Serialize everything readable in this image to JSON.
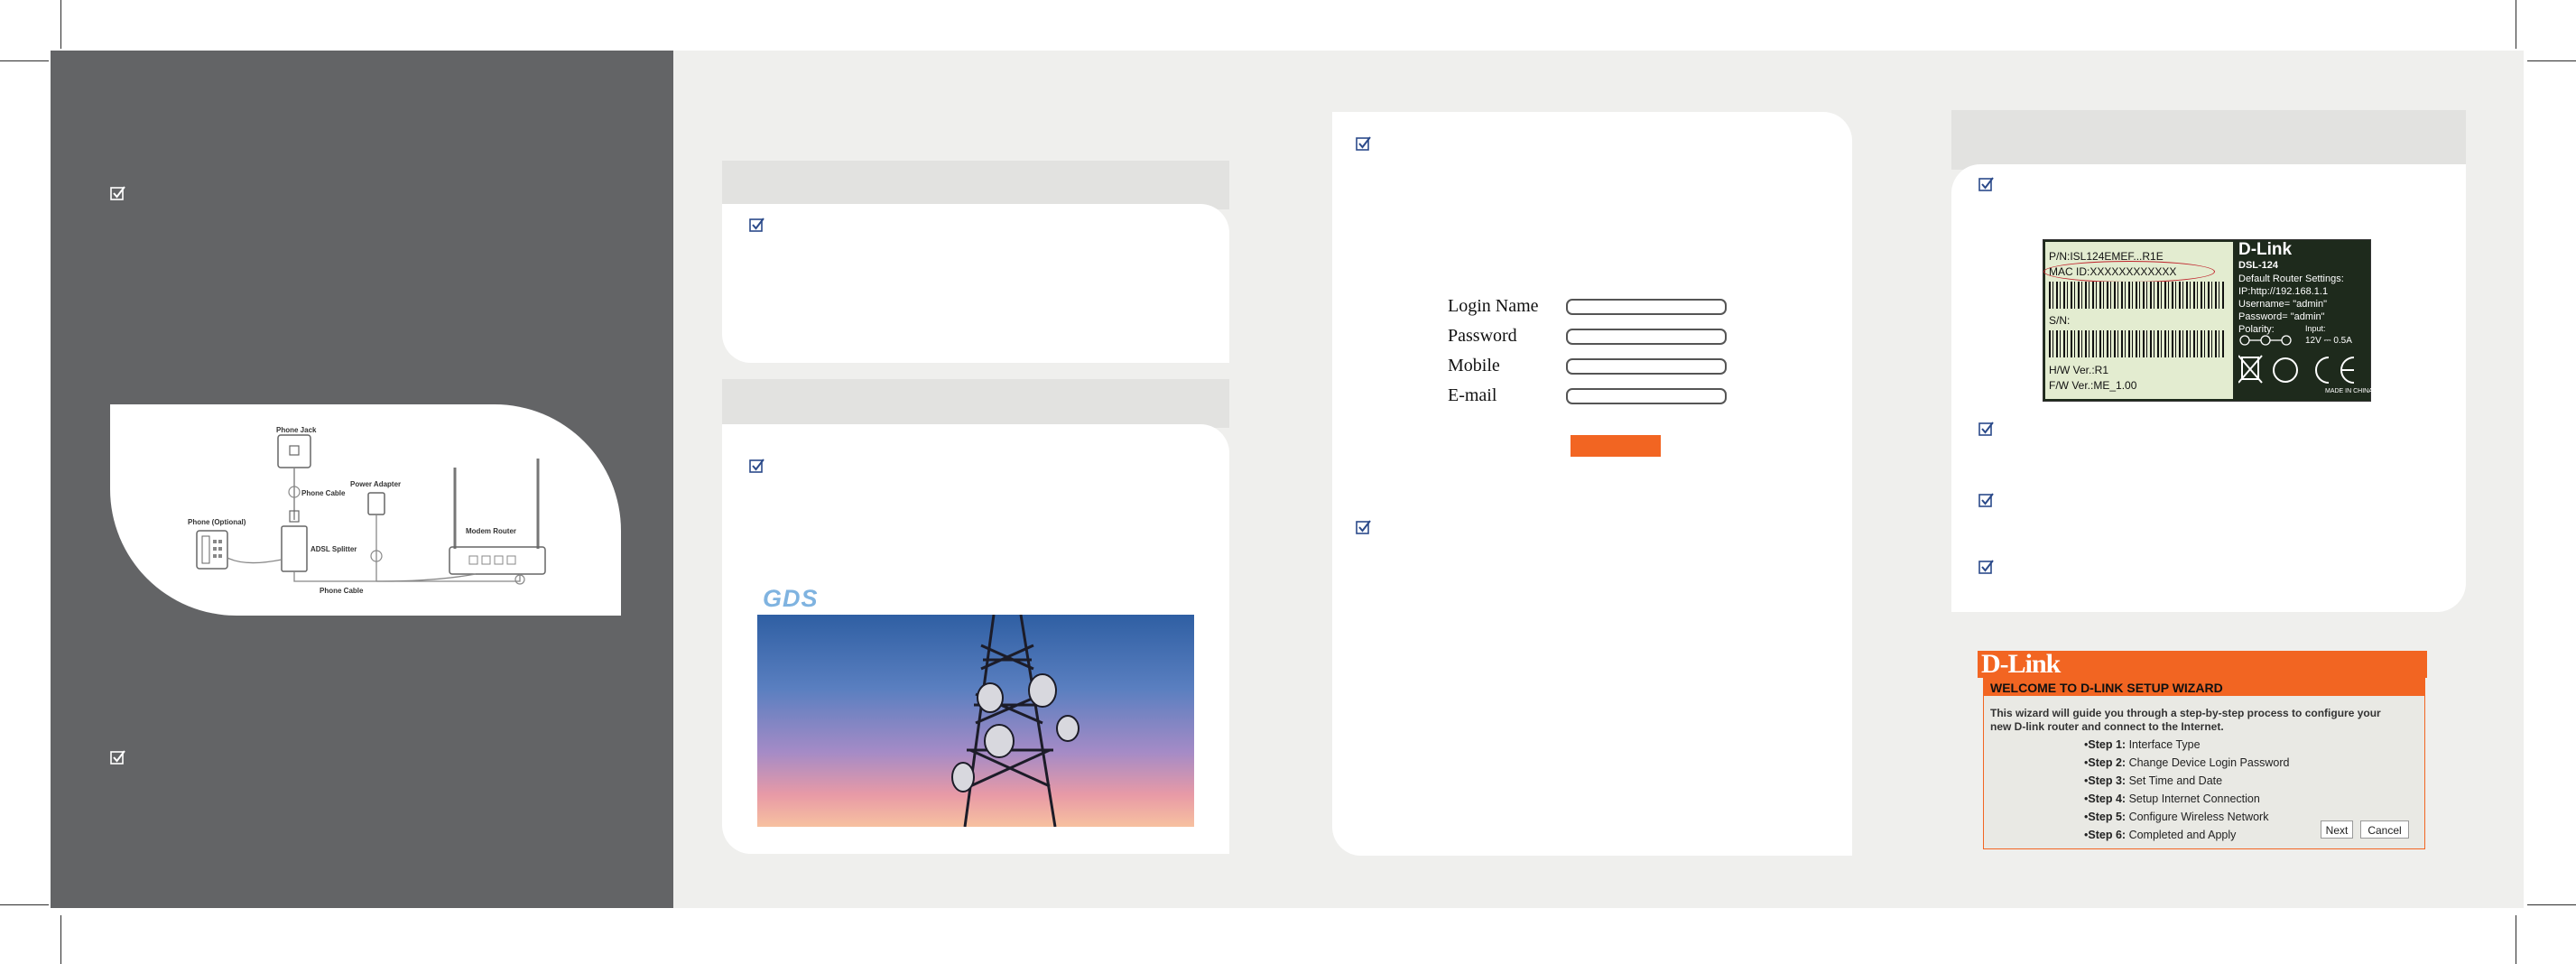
{
  "diagram": {
    "phone_jack": "Phone Jack",
    "phone_cable_top": "Phone Cable",
    "power_adapter": "Power Adapter",
    "phone_optional": "Phone (Optional)",
    "adsl_splitter": "ADSL Splitter",
    "modem_router": "Modem Router",
    "phone_cable_bottom": "Phone Cable"
  },
  "brand_logo": "GDS",
  "login_form": {
    "login_name": "Login Name",
    "password": "Password",
    "mobile": "Mobile",
    "email": "E-mail",
    "submit_color": "#f26522"
  },
  "router_label": {
    "pn": "P/N:ISL124EMEF...R1E",
    "mac": "MAC ID:XXXXXXXXXXXX",
    "sn": "S/N:",
    "hw": "H/W Ver.:R1",
    "fw": "F/W Ver.:ME_1.00",
    "brand": "D-Link",
    "model": "DSL-124",
    "settings_title": "Default Router Settings:",
    "ip": "IP:http://192.168.1.1",
    "username": "Username= \"admin\"",
    "password": "Password= \"admin\"",
    "polarity": "Polarity:",
    "input": "Input:",
    "power": "12V ⎓ 0.5A",
    "made_in": "MADE IN CHINA"
  },
  "wizard": {
    "brand": "D-Link",
    "title": "WELCOME TO D-LINK SETUP WIZARD",
    "intro_1": "This wizard will guide you through a step-by-step process to configure your",
    "intro_2": "new D-link router and connect to the Internet.",
    "steps": [
      {
        "label": "Step 1:",
        "text": "Interface Type"
      },
      {
        "label": "Step 2:",
        "text": "Change Device Login Password"
      },
      {
        "label": "Step 3:",
        "text": "Set Time and Date"
      },
      {
        "label": "Step 4:",
        "text": "Setup Internet Connection"
      },
      {
        "label": "Step 5:",
        "text": "Configure Wireless Network"
      },
      {
        "label": "Step 6:",
        "text": "Completed and Apply"
      }
    ],
    "next": "Next",
    "cancel": "Cancel",
    "accent": "#f26522"
  }
}
